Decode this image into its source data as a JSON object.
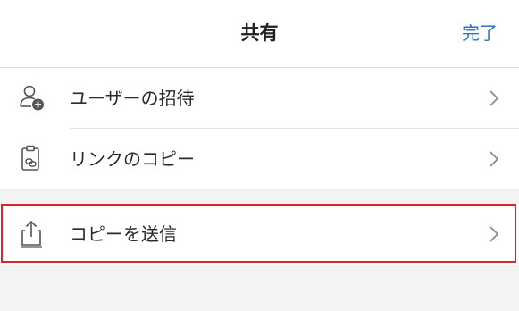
{
  "header": {
    "title": "共有",
    "done_label": "完了"
  },
  "items": [
    {
      "label": "ユーザーの招待",
      "icon": "invite-user-icon"
    },
    {
      "label": "リンクのコピー",
      "icon": "copy-link-icon"
    },
    {
      "label": "コピーを送信",
      "icon": "share-upload-icon"
    }
  ],
  "colors": {
    "accent": "#2f73c3",
    "highlight": "#d9262b",
    "background": "#f3f3f3"
  }
}
